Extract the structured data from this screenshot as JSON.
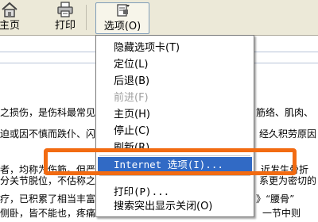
{
  "toolbar": {
    "home_label": "主页",
    "print_label": "打印",
    "options_label": "选项(O)"
  },
  "document": {
    "lines": [
      "之损伤，是伤科最常见",
      "迫或因不慎而跌仆、闪",
      "者，均称为伤筋。但严",
      "分关节脱位，不估称之",
      "疗，已积累了相当丰富",
      "侧卧，皆不能也，疼痛"
    ],
    "right_fragments": [
      "筋络、肌肉、",
      "经久积劳原因",
      "近发生骨折",
      "系更为密切的",
      "》“腰骨”",
      "一节中则"
    ]
  },
  "menu": {
    "items": [
      {
        "label": "隐藏选项卡(T)",
        "disabled": false
      },
      {
        "label": "定位(L)",
        "disabled": false
      },
      {
        "label": "后退(B)",
        "disabled": false
      },
      {
        "label": "前进(F)",
        "disabled": true
      },
      {
        "label": "主页(H)",
        "disabled": false
      },
      {
        "label": "停止(C)",
        "disabled": false
      },
      {
        "label": "刷新(R)",
        "disabled": false
      },
      {
        "label": "Internet 选项(I)...",
        "disabled": false,
        "highlighted": true
      },
      {
        "label": "打印(P)...",
        "disabled": false
      },
      {
        "label": "搜索突出显示关闭(O)",
        "disabled": false
      }
    ]
  },
  "colors": {
    "highlight": "#316ac5",
    "annotation": "#f26b12",
    "toolbar_bg": "#ece9d8"
  }
}
